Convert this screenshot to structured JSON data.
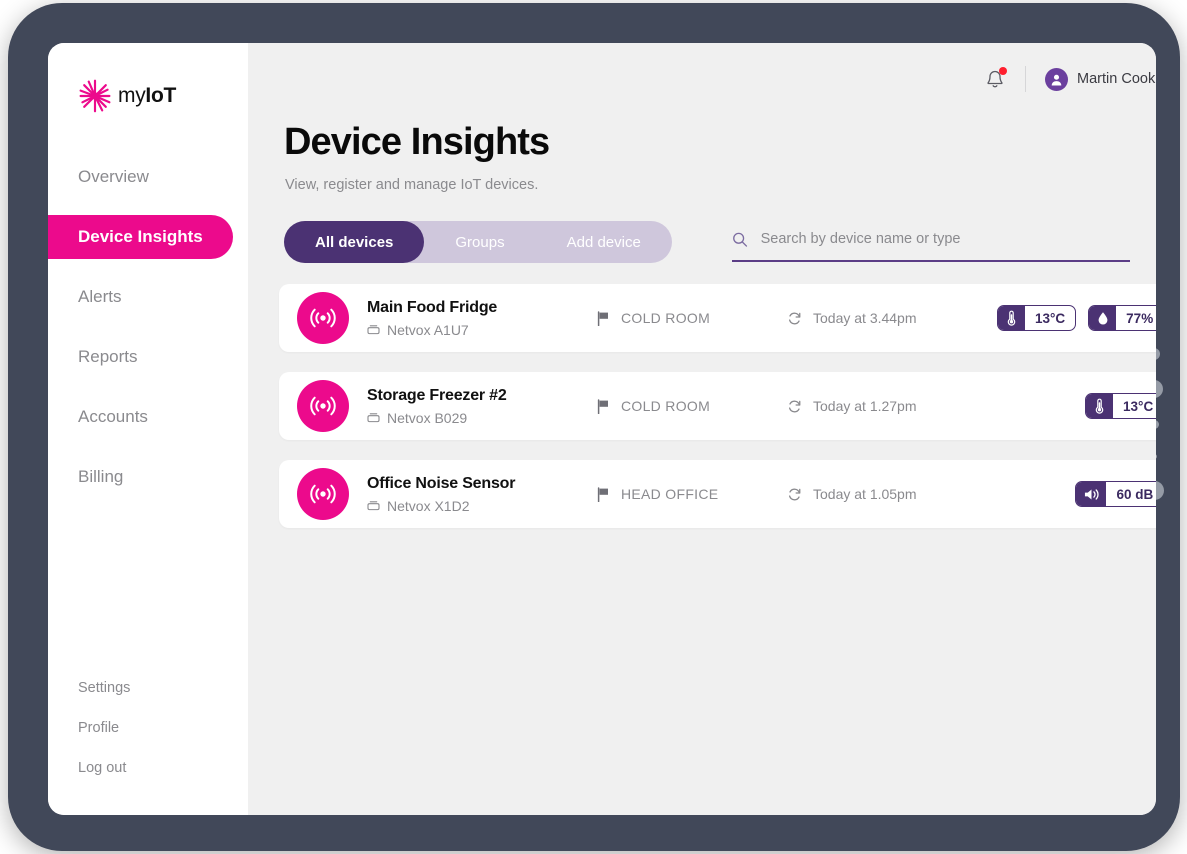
{
  "brand": {
    "name_light": "my",
    "name_bold": "IoT",
    "logo_icon": "asterisk-burst-logo"
  },
  "colors": {
    "pink": "#ec0a8c",
    "purple_dark": "#4b3273",
    "purple_light": "#cfc7dc",
    "avatar_purple": "#6b3f9e",
    "frame": "#414859",
    "screen_bg": "#f0f0f0",
    "notification_red": "#ff1f2e"
  },
  "sidebar": {
    "items": [
      {
        "label": "Overview",
        "active": false
      },
      {
        "label": "Device Insights",
        "active": true
      },
      {
        "label": "Alerts",
        "active": false
      },
      {
        "label": "Reports",
        "active": false
      },
      {
        "label": "Accounts",
        "active": false
      },
      {
        "label": "Billing",
        "active": false
      }
    ],
    "footer_items": [
      {
        "label": "Settings"
      },
      {
        "label": "Profile"
      },
      {
        "label": "Log out"
      }
    ]
  },
  "topbar": {
    "bell_icon": "notification-bell-icon",
    "has_unread": true,
    "avatar_icon": "user-avatar-icon",
    "user_name": "Martin Cook",
    "caret_icon": "chevron-down-icon"
  },
  "page": {
    "title": "Device Insights",
    "subtitle": "View, register and manage IoT devices."
  },
  "tabs": [
    {
      "label": "All devices",
      "active": true
    },
    {
      "label": "Groups",
      "active": false
    },
    {
      "label": "Add device",
      "active": false
    }
  ],
  "search": {
    "placeholder": "Search by device name or type",
    "value": "",
    "icon": "search-icon"
  },
  "devices": [
    {
      "icon": "signal-broadcast-icon",
      "name": "Main Food Fridge",
      "model_icon": "hardware-chip-icon",
      "model": "Netvox A1U7",
      "location_icon": "flag-icon",
      "location": "COLD ROOM",
      "updated_icon": "refresh-icon",
      "updated": "Today at 3.44pm",
      "metrics": [
        {
          "icon": "thermometer-icon",
          "value": "13°C"
        },
        {
          "icon": "humidity-droplet-icon",
          "value": "77%"
        }
      ]
    },
    {
      "icon": "signal-broadcast-icon",
      "name": "Storage Freezer #2",
      "model_icon": "hardware-chip-icon",
      "model": "Netvox B029",
      "location_icon": "flag-icon",
      "location": "COLD ROOM",
      "updated_icon": "refresh-icon",
      "updated": "Today at 1.27pm",
      "metrics": [
        {
          "icon": "thermometer-icon",
          "value": "13°C"
        }
      ]
    },
    {
      "icon": "signal-broadcast-icon",
      "name": "Office Noise Sensor",
      "model_icon": "hardware-chip-icon",
      "model": "Netvox X1D2",
      "location_icon": "flag-icon",
      "location": "HEAD OFFICE",
      "updated_icon": "refresh-icon",
      "updated": "Today at 1.05pm",
      "metrics": [
        {
          "icon": "speaker-volume-icon",
          "value": "60 dB"
        }
      ]
    }
  ],
  "device_frame": {
    "bezel_buttons": [
      "button-1",
      "button-2",
      "button-3",
      "button-4",
      "button-5"
    ]
  }
}
